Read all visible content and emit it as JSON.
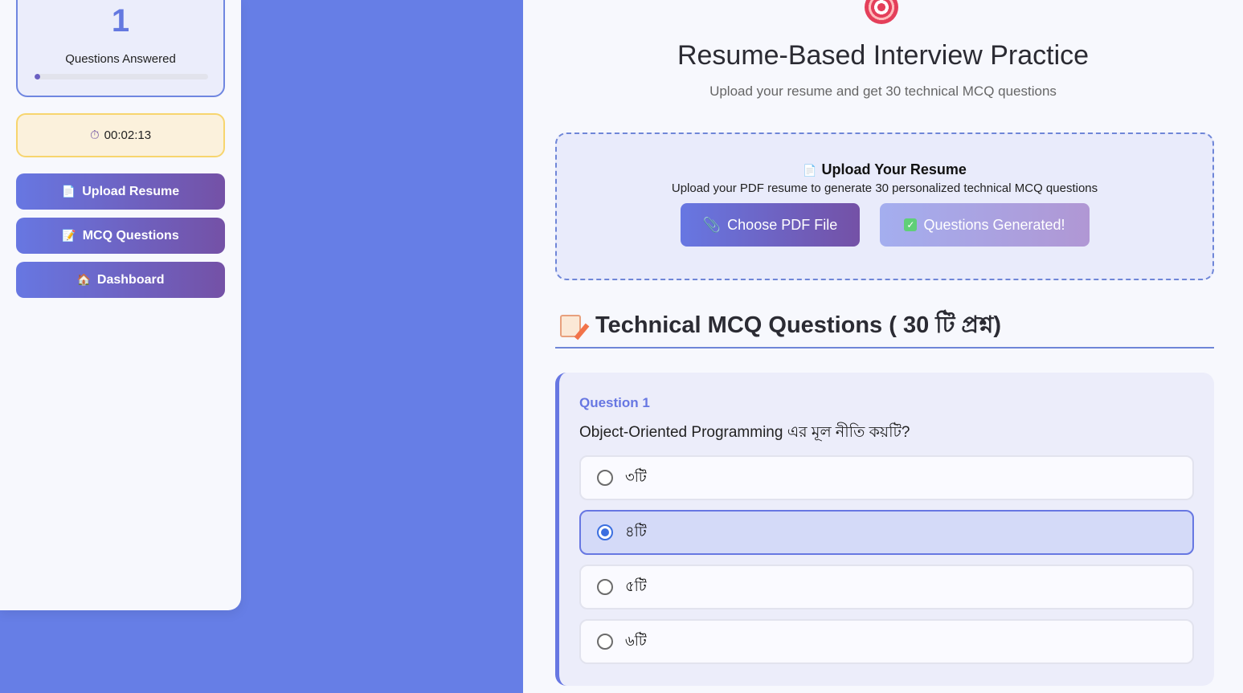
{
  "sidebar": {
    "stats": {
      "answered_count": "1",
      "answered_label": "Questions Answered",
      "progress_fraction": 0.033
    },
    "timer": {
      "icon": "stopwatch-icon",
      "value": "00:02:13"
    },
    "nav": [
      {
        "icon": "page-icon",
        "label": "Upload Resume"
      },
      {
        "icon": "memo-icon",
        "label": "MCQ Questions"
      },
      {
        "icon": "house-icon",
        "label": "Dashboard"
      }
    ]
  },
  "main": {
    "header_icon": "target-icon",
    "title": "Resume-Based Interview Practice",
    "subtitle": "Upload your resume and get 30 technical MCQ questions",
    "upload": {
      "icon": "page-icon",
      "title": "Upload Your Resume",
      "description": "Upload your PDF resume to generate 30 personalized technical MCQ questions",
      "choose_label": "Choose PDF File",
      "choose_icon": "paperclip-icon",
      "generated_label": "Questions Generated!",
      "generated_icon": "check-icon"
    },
    "section": {
      "icon": "memo-icon",
      "title": "Technical MCQ Questions (  30  টি প্রশ্ন)"
    },
    "question": {
      "number": "Question 1",
      "text": "Object-Oriented Programming এর মূল নীতি কয়টি?",
      "options": [
        {
          "label": "৩টি",
          "selected": false
        },
        {
          "label": "৪টি",
          "selected": true
        },
        {
          "label": "৫টি",
          "selected": false
        },
        {
          "label": "৬টি",
          "selected": false
        }
      ]
    }
  },
  "colors": {
    "accent": "#6777e2",
    "accent_end": "#7451a6",
    "background": "#667ee6",
    "timer_bg": "#fbf1dc",
    "timer_border": "#f7d56e"
  }
}
